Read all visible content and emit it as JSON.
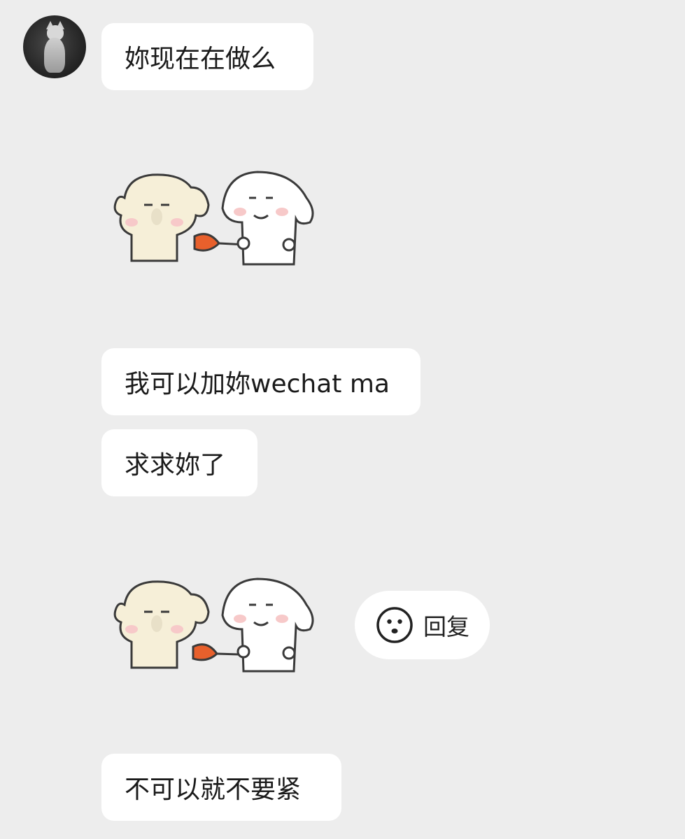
{
  "messages": [
    {
      "text": "妳现在在做么"
    },
    {
      "text": "我可以加妳wechat ma"
    },
    {
      "text": "求求妳了"
    },
    {
      "text": "不可以就不要紧"
    }
  ],
  "reply_chip": {
    "label": "回复",
    "icon": "smiley-face-icon"
  },
  "stickers": [
    {
      "icon": "dog-and-bun-sticker"
    },
    {
      "icon": "dog-and-bun-sticker"
    }
  ],
  "colors": {
    "background": "#ededed",
    "bubble": "#ffffff",
    "text": "#1a1a1a",
    "sticker_outline": "#3a3a3a",
    "sticker_dog": "#f6efd8",
    "plunger": "#e8602c"
  }
}
